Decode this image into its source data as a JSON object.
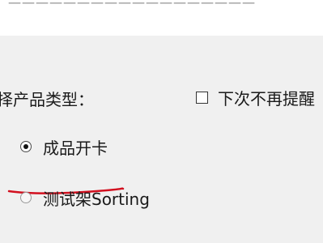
{
  "top_text": "一一一一一一一一一一一一一一一一一一",
  "prompt_label": "择产品类型：",
  "dont_remind_checkbox": {
    "label": "下次不再提醒",
    "checked": false
  },
  "product_type_options": [
    {
      "label": "成品开卡",
      "selected": true
    },
    {
      "label": "测试架Sorting",
      "selected": false
    }
  ],
  "annotation_color": "#d2101f"
}
